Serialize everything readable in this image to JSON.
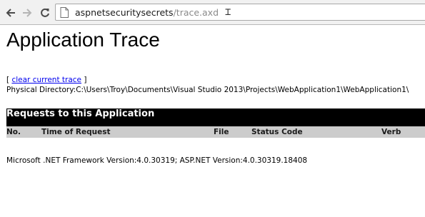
{
  "browser": {
    "url_host": "aspnetsecuritysecrets",
    "url_path": "/trace.axd",
    "icons": {
      "back": "arrow-left-icon",
      "forward": "arrow-right-icon",
      "reload": "reload-icon",
      "page": "page-icon",
      "cursor": "text-cursor-icon"
    }
  },
  "page": {
    "title": "Application Trace",
    "clear_link": {
      "open_bracket": "[",
      "label": "clear current trace",
      "close_bracket": "]"
    },
    "physical_directory": {
      "label": "Physical Directory:",
      "path": "C:\\Users\\Troy\\Documents\\Visual Studio 2013\\Projects\\WebApplication1\\WebApplication1\\"
    },
    "requests_table": {
      "heading": "Requests to this Application",
      "columns": [
        "No.",
        "Time of Request",
        "File",
        "Status Code",
        "Verb"
      ],
      "rows": []
    },
    "version_info": "Microsoft .NET Framework Version:4.0.30319; ASP.NET Version:4.0.30319.18408"
  }
}
